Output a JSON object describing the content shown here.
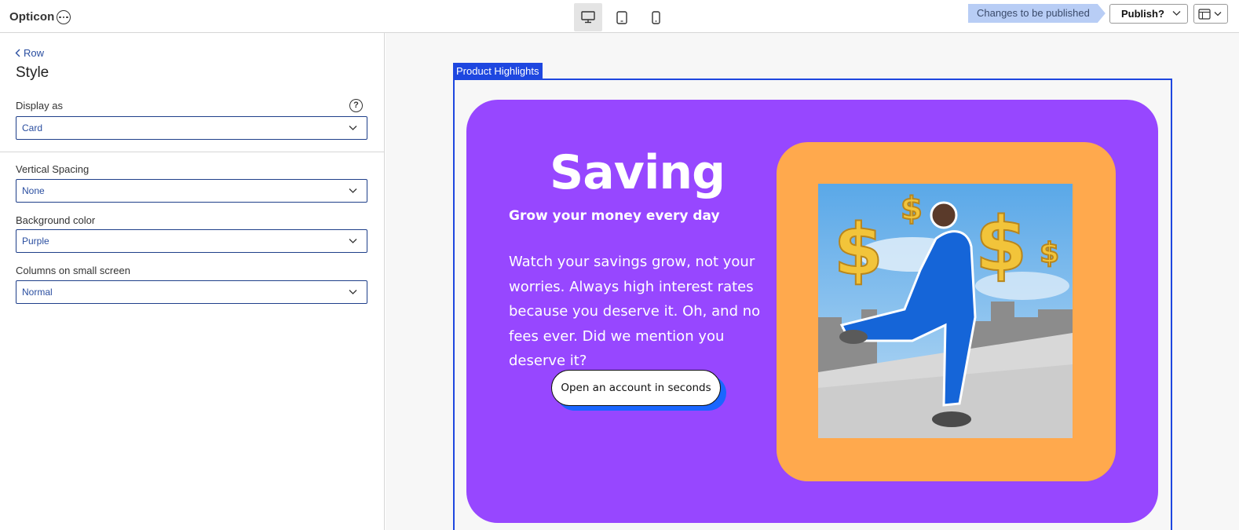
{
  "topbar": {
    "brand": "Opticon",
    "devices": [
      {
        "name": "desktop",
        "active": true
      },
      {
        "name": "tablet",
        "active": false
      },
      {
        "name": "mobile",
        "active": false
      }
    ],
    "status": "Changes to be published",
    "publish_label": "Publish?"
  },
  "panel": {
    "back_label": "Row",
    "title": "Style",
    "fields": [
      {
        "label": "Display as",
        "value": "Card"
      },
      {
        "label": "Vertical Spacing",
        "value": "None"
      },
      {
        "label": "Background color",
        "value": "Purple"
      },
      {
        "label": "Columns on small screen",
        "value": "Normal"
      }
    ],
    "help_symbol": "?"
  },
  "canvas": {
    "block_tag": "Product Highlights",
    "card": {
      "heading": "Saving",
      "subheading": "Grow your money every day",
      "body": "Watch your savings grow, not your worries. Always high interest rates because you deserve it. Oh, and no fees ever. Did we mention you deserve it?",
      "cta_label": "Open an account in seconds",
      "colors": {
        "card": "#9747ff",
        "image_frame": "#ffa94d",
        "cta_shadow": "#1a66ff"
      }
    }
  },
  "colors": {
    "accent": "#1e47e0",
    "status_pill": "#b8cdf5",
    "link": "#2a4ea0"
  }
}
